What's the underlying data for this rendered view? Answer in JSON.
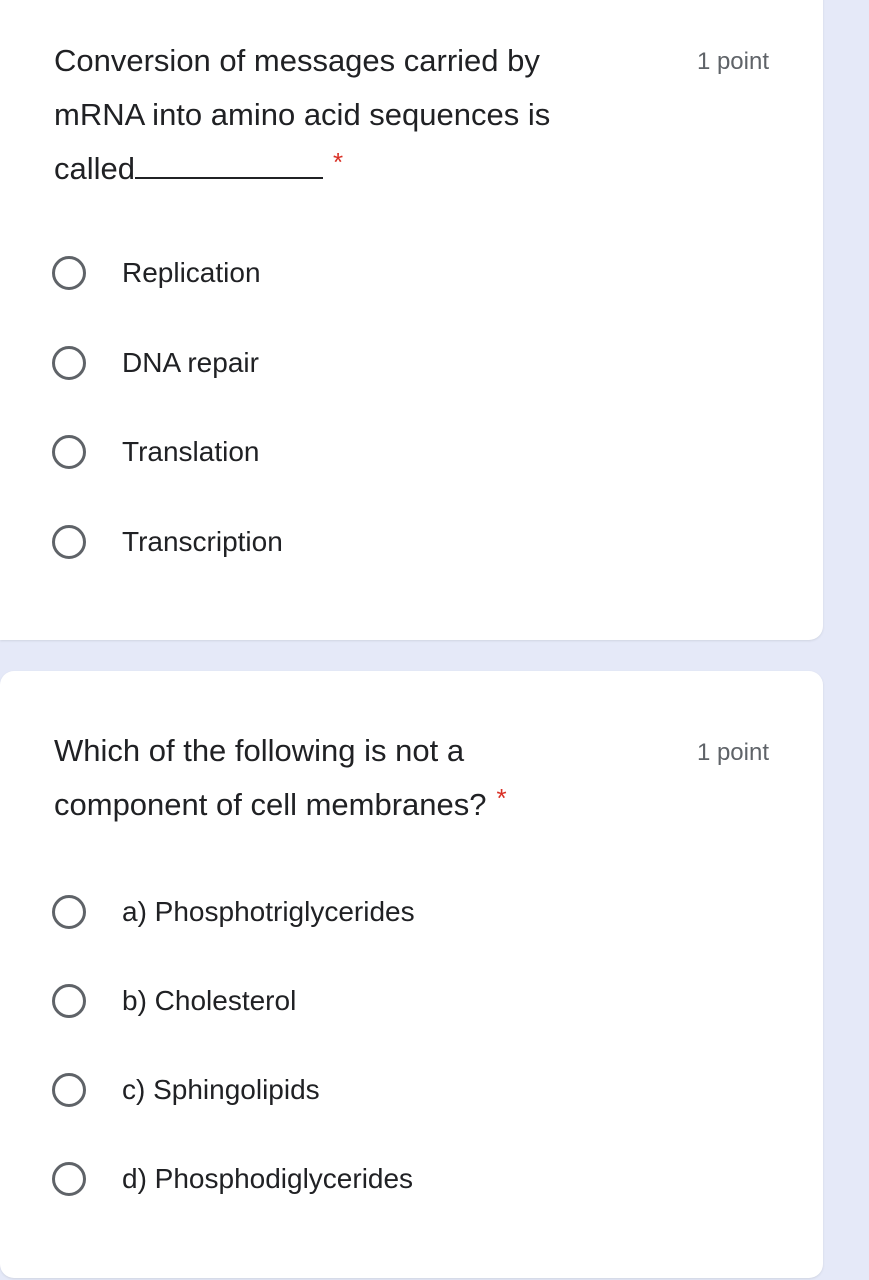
{
  "questions": [
    {
      "title_lines": [
        "Conversion of messages carried by",
        "mRNA into amino acid sequences is",
        "called"
      ],
      "blank": true,
      "required_mark": "*",
      "points": "1 point",
      "options": [
        "Replication",
        "DNA repair",
        "Translation",
        "Transcription"
      ]
    },
    {
      "title_lines": [
        "Which of the following is not a",
        "component of cell membranes?"
      ],
      "blank": false,
      "required_mark": "*",
      "points": "1 point",
      "options": [
        "a) Phosphotriglycerides",
        "b) Cholesterol",
        "c) Sphingolipids",
        "d) Phosphodiglycerides"
      ]
    }
  ],
  "colors": {
    "background": "#e5e9f8",
    "required": "#d93025",
    "text": "#202124",
    "secondary": "#5f6368"
  }
}
